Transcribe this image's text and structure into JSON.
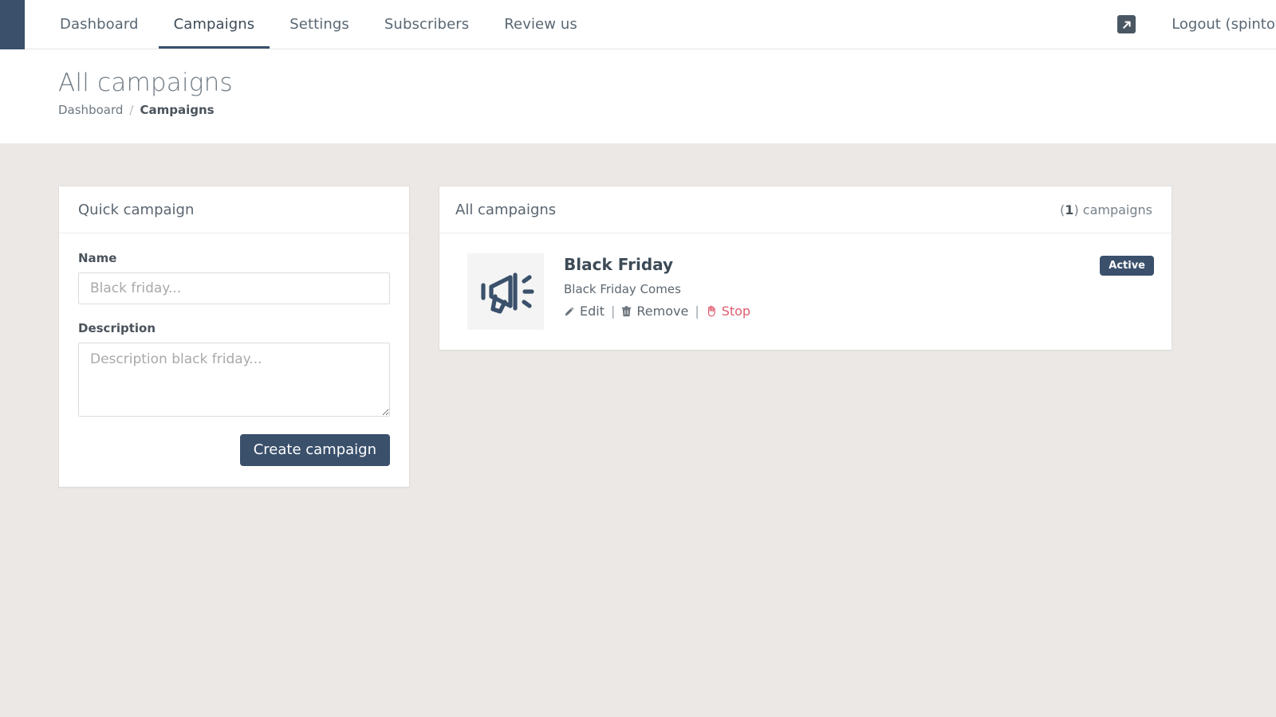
{
  "nav": {
    "tabs": [
      {
        "label": "Dashboard",
        "active": false
      },
      {
        "label": "Campaigns",
        "active": true
      },
      {
        "label": "Settings",
        "active": false
      },
      {
        "label": "Subscribers",
        "active": false
      },
      {
        "label": "Review us",
        "active": false
      }
    ],
    "external_link_icon": "external-link-icon",
    "logout_label": "Logout (spintowin"
  },
  "page": {
    "title": "All campaigns",
    "breadcrumb": {
      "root": "Dashboard",
      "separator": "/",
      "current": "Campaigns"
    }
  },
  "quick_campaign": {
    "card_title": "Quick campaign",
    "name_label": "Name",
    "name_value": "",
    "name_placeholder": "Black friday...",
    "description_label": "Description",
    "description_value": "",
    "description_placeholder": "Description black friday...",
    "submit_label": "Create campaign"
  },
  "campaign_list": {
    "card_title": "All campaigns",
    "count": "1",
    "count_suffix": ") campaigns",
    "count_prefix": "(",
    "items": [
      {
        "name": "Black Friday",
        "description": "Black Friday Comes",
        "thumb_icon": "megaphone-icon",
        "status_badge": "Active",
        "actions": {
          "edit": "Edit",
          "remove": "Remove",
          "stop": "Stop",
          "separator": "|"
        }
      }
    ]
  },
  "colors": {
    "brand_navy": "#3a506b",
    "page_background": "#ebe8e6",
    "card_white": "#ffffff",
    "danger_red": "#e05c6e",
    "text_muted": "#5c666f"
  }
}
